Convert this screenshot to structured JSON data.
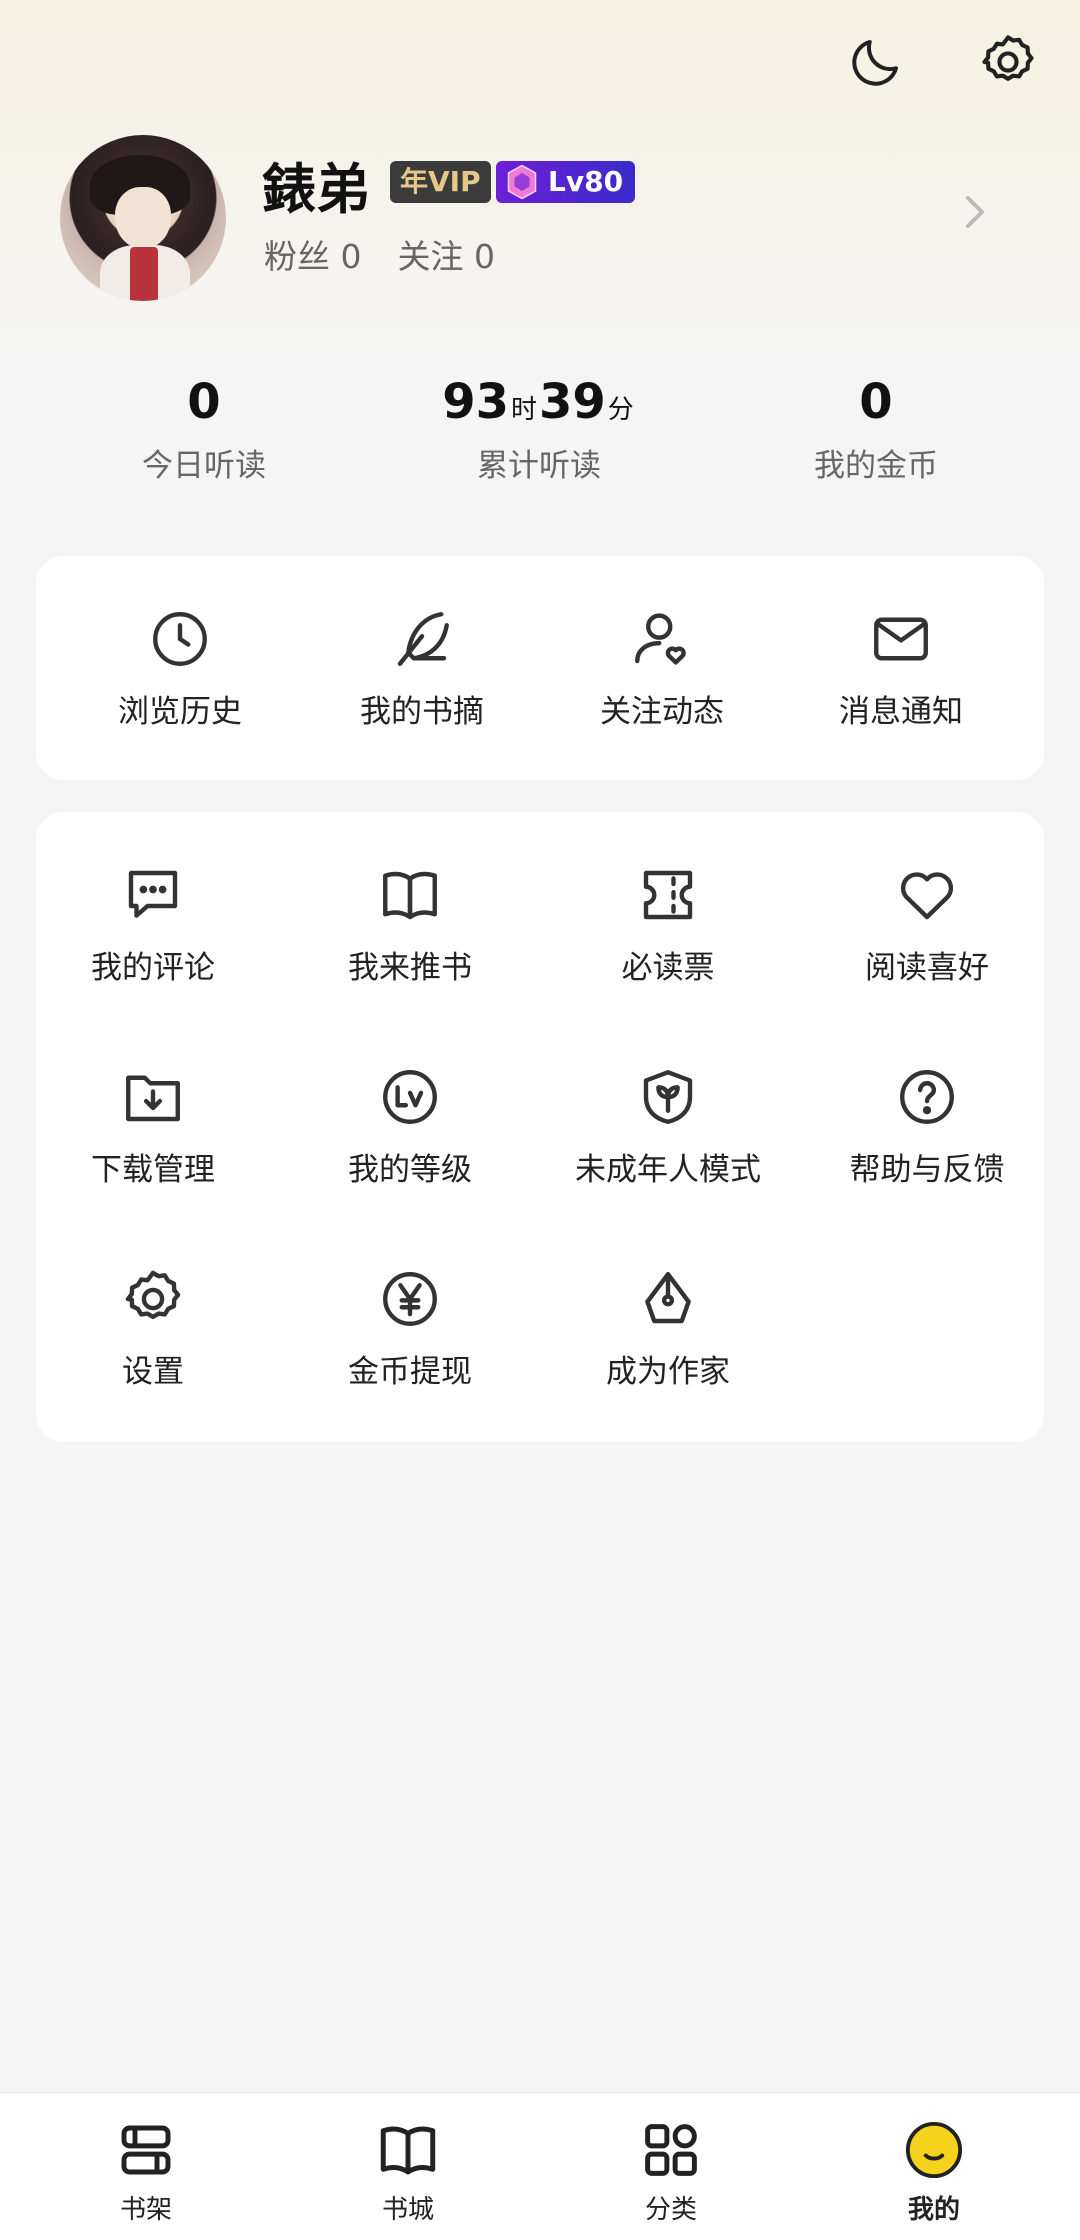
{
  "profile": {
    "username": "錶弟",
    "vip_badge": "年VIP",
    "level_badge": "Lv80",
    "fans": "粉丝 0",
    "following": "关注 0"
  },
  "stats": [
    {
      "value": "0",
      "label": "今日听读"
    },
    {
      "hours": "93",
      "hours_unit": "时",
      "minutes": "39",
      "minutes_unit": "分",
      "label": "累计听读"
    },
    {
      "value": "0",
      "label": "我的金币"
    }
  ],
  "quick_menu": [
    {
      "label": "浏览历史",
      "icon": "clock-icon"
    },
    {
      "label": "我的书摘",
      "icon": "feather-icon"
    },
    {
      "label": "关注动态",
      "icon": "user-heart-icon"
    },
    {
      "label": "消息通知",
      "icon": "mail-icon"
    }
  ],
  "services": [
    {
      "label": "我的评论",
      "icon": "comment-icon"
    },
    {
      "label": "我来推书",
      "icon": "open-book-icon"
    },
    {
      "label": "必读票",
      "icon": "ticket-icon"
    },
    {
      "label": "阅读喜好",
      "icon": "heart-icon"
    },
    {
      "label": "下载管理",
      "icon": "download-folder-icon"
    },
    {
      "label": "我的等级",
      "icon": "level-icon"
    },
    {
      "label": "未成年人模式",
      "icon": "shield-sprout-icon"
    },
    {
      "label": "帮助与反馈",
      "icon": "help-icon"
    },
    {
      "label": "设置",
      "icon": "gear-icon"
    },
    {
      "label": "金币提现",
      "icon": "yen-coin-icon"
    },
    {
      "label": "成为作家",
      "icon": "pen-nib-icon"
    }
  ],
  "tabs": [
    {
      "label": "书架",
      "icon": "bookshelf-icon"
    },
    {
      "label": "书城",
      "icon": "book-icon"
    },
    {
      "label": "分类",
      "icon": "grid-icon"
    },
    {
      "label": "我的",
      "icon": "smiley-icon",
      "active": true
    }
  ],
  "colors": {
    "accent_yellow": "#f5d31c",
    "vip_text": "#e6c889",
    "level_badge": "#5a24d0"
  }
}
